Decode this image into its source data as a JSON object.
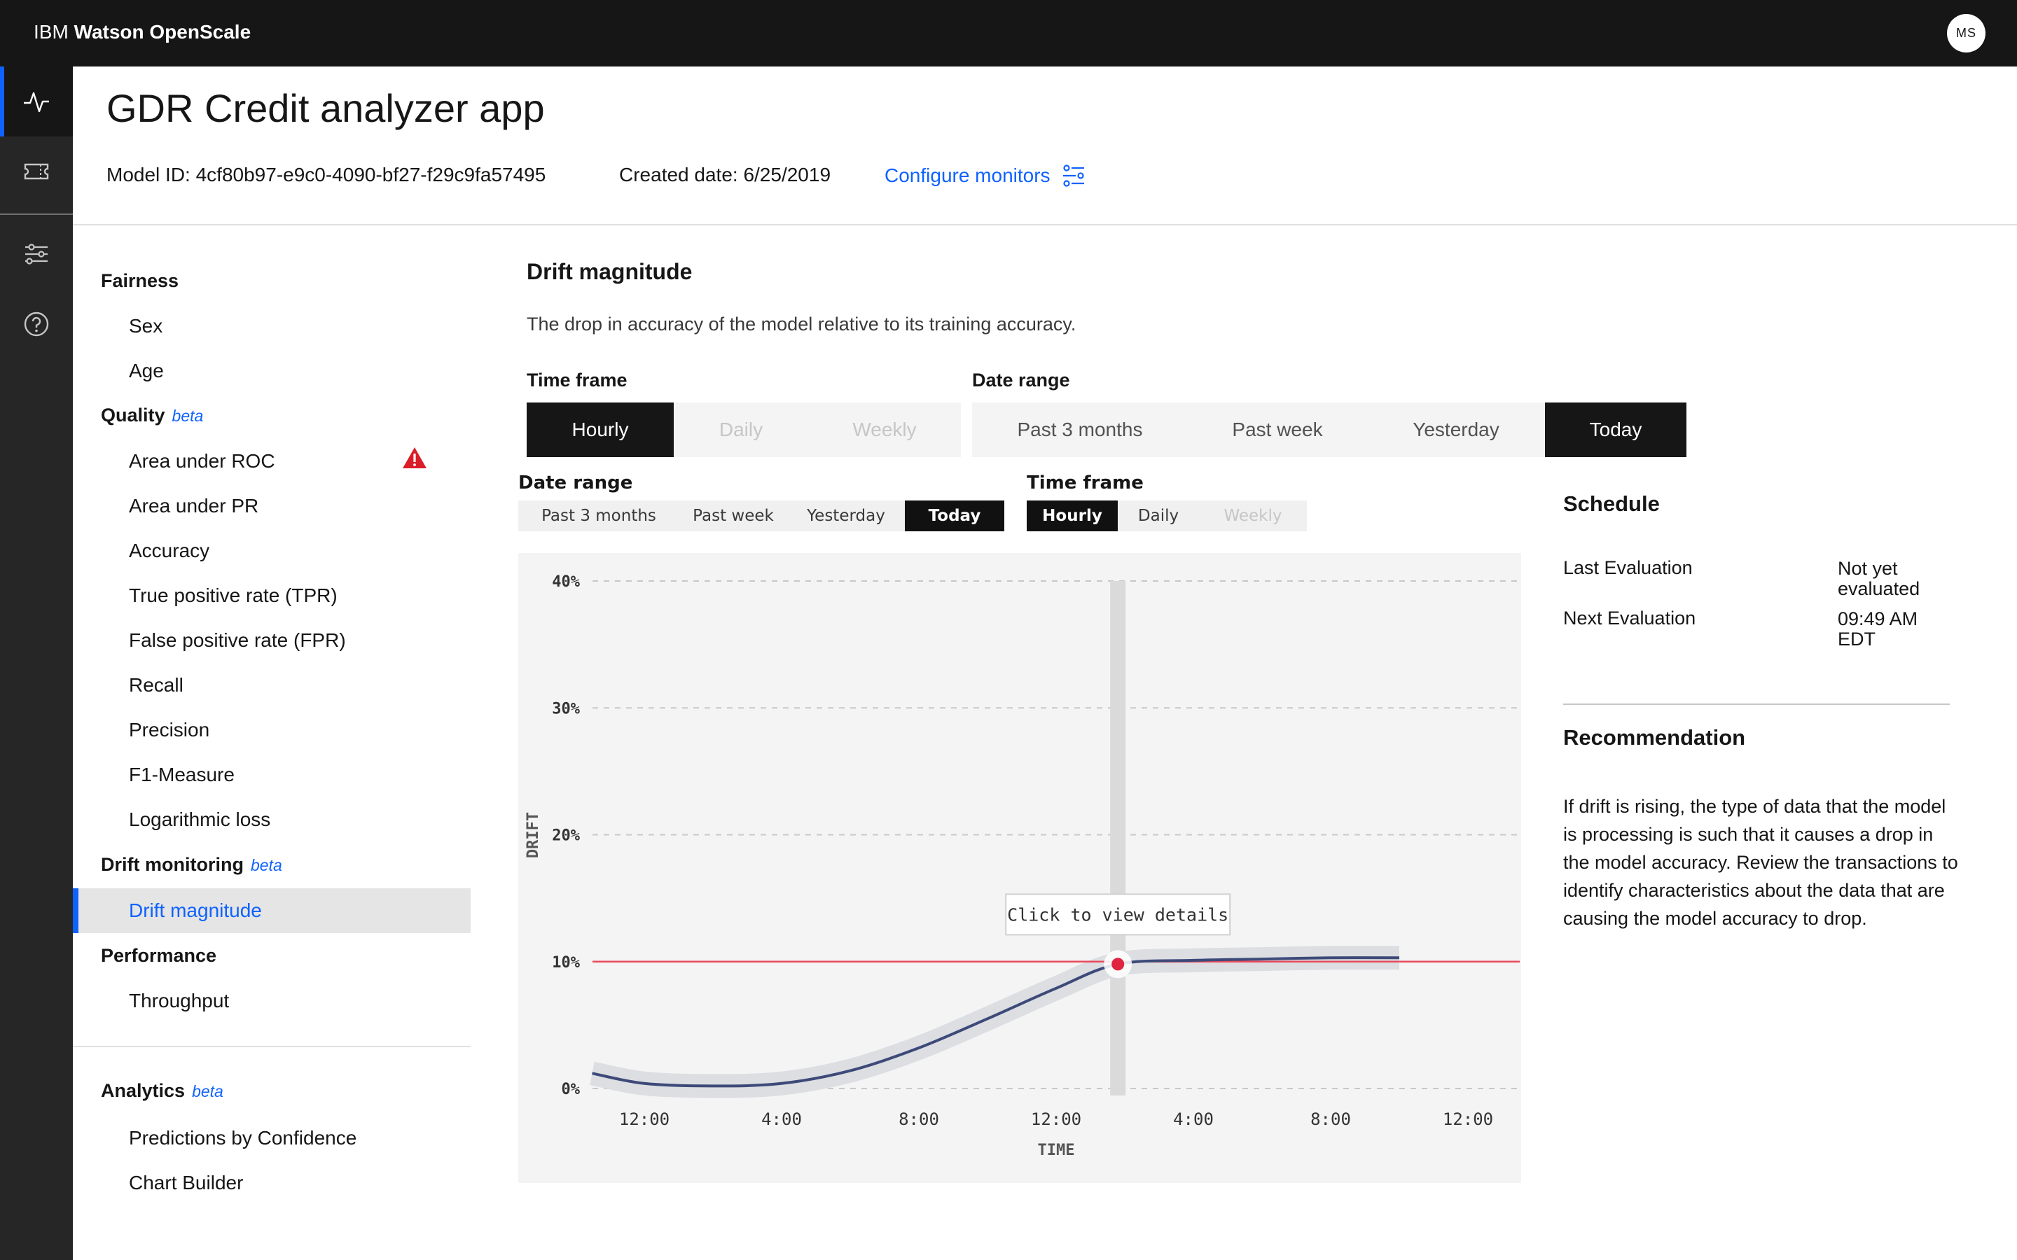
{
  "app": {
    "brand_prefix": "IBM",
    "brand_name": "Watson OpenScale",
    "user_initials": "MS"
  },
  "rail": {
    "icons": [
      "activity-icon",
      "ticket-icon",
      "sliders-icon",
      "help-icon"
    ]
  },
  "header": {
    "title": "GDR Credit analyzer app",
    "model_id": "Model ID: 4cf80b97-e9c0-4090-bf27-f29c9fa57495",
    "created_date": "Created date: 6/25/2019",
    "configure_label": "Configure monitors"
  },
  "sidenav": {
    "fairness": {
      "label": "Fairness",
      "items": [
        "Sex",
        "Age"
      ]
    },
    "quality": {
      "label": "Quality",
      "badge": "beta",
      "items": [
        "Area under ROC",
        "Area under PR",
        "Accuracy",
        "True positive rate (TPR)",
        "False positive rate (FPR)",
        "Recall",
        "Precision",
        "F1-Measure",
        "Logarithmic loss"
      ]
    },
    "drift": {
      "label": "Drift monitoring",
      "badge": "beta",
      "items": [
        "Drift magnitude"
      ]
    },
    "performance": {
      "label": "Performance",
      "items": [
        "Throughput"
      ]
    },
    "analytics": {
      "label": "Analytics",
      "badge": "beta",
      "items": [
        "Predictions by Confidence",
        "Chart Builder"
      ]
    }
  },
  "main": {
    "title": "Drift magnitude",
    "description": "The drop in accuracy of the model relative to its training accuracy.",
    "time_frame": {
      "label": "Time frame",
      "options": [
        "Hourly",
        "Daily",
        "Weekly"
      ],
      "selected": "Hourly"
    },
    "date_range": {
      "label": "Date range",
      "options": [
        "Past 3 months",
        "Past week",
        "Yesterday",
        "Today"
      ],
      "selected": "Today"
    }
  },
  "chart_panel": {
    "date_range": {
      "label": "Date range",
      "options": [
        "Past 3 months",
        "Past week",
        "Yesterday",
        "Today"
      ],
      "selected": "Today"
    },
    "time_frame": {
      "label": "Time frame",
      "options": [
        "Hourly",
        "Daily",
        "Weekly"
      ],
      "selected": "Hourly"
    },
    "tooltip": "Click to view details"
  },
  "chart_data": {
    "type": "line",
    "title": "",
    "xlabel": "TIME",
    "ylabel": "DRIFT",
    "ylim": [
      0,
      40
    ],
    "y_ticks": [
      "0%",
      "10%",
      "20%",
      "30%",
      "40%"
    ],
    "x_ticks": [
      "12:00",
      "4:00",
      "8:00",
      "12:00",
      "4:00",
      "8:00",
      "12:00"
    ],
    "grid": "horizontal dashed",
    "series": [
      {
        "values": [
          1.2,
          0.4,
          0.2,
          0.4,
          1.4,
          3.2,
          5.5,
          7.9,
          9.8,
          10.1,
          10.2,
          10.3,
          10.3
        ]
      }
    ],
    "x_positions": [
      -0.38,
      0.0,
      0.5,
      1.0,
      1.5,
      2.0,
      2.5,
      3.0,
      3.45,
      4.0,
      4.5,
      5.0,
      5.5
    ],
    "threshold": 10,
    "highlight_x": 3.45,
    "colors": {
      "series": "#3d4a79",
      "band": "#dcdee2",
      "threshold": "#e8495c",
      "marker": "#e0233f"
    }
  },
  "schedule": {
    "title": "Schedule",
    "last_label": "Last Evaluation",
    "last_value": "Not yet evaluated",
    "next_label": "Next Evaluation",
    "next_value": "09:49 AM EDT"
  },
  "recommendation": {
    "title": "Recommendation",
    "text": "If drift is rising, the type of data that the model is processing is such that it causes a drop in the model accuracy. Review the transactions to identify characteristics about the data that are causing the model accuracy to drop."
  }
}
